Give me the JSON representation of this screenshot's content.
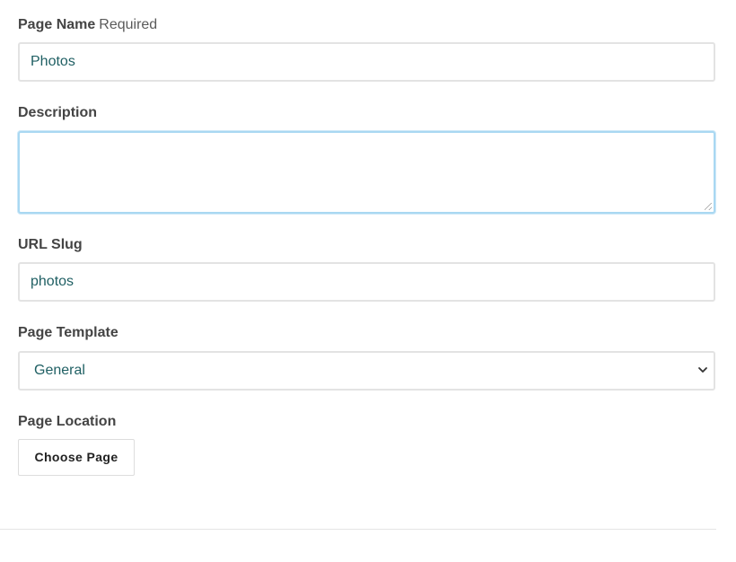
{
  "form": {
    "page_name": {
      "label": "Page Name",
      "hint": "Required",
      "value": "Photos"
    },
    "description": {
      "label": "Description",
      "value": ""
    },
    "url_slug": {
      "label": "URL Slug",
      "value": "photos"
    },
    "page_template": {
      "label": "Page Template",
      "selected": "General"
    },
    "page_location": {
      "label": "Page Location",
      "button_label": "Choose Page"
    }
  },
  "colors": {
    "input_text": "#1f5f63",
    "focus_border": "#a9d8f2",
    "border": "#e3e3e3"
  }
}
